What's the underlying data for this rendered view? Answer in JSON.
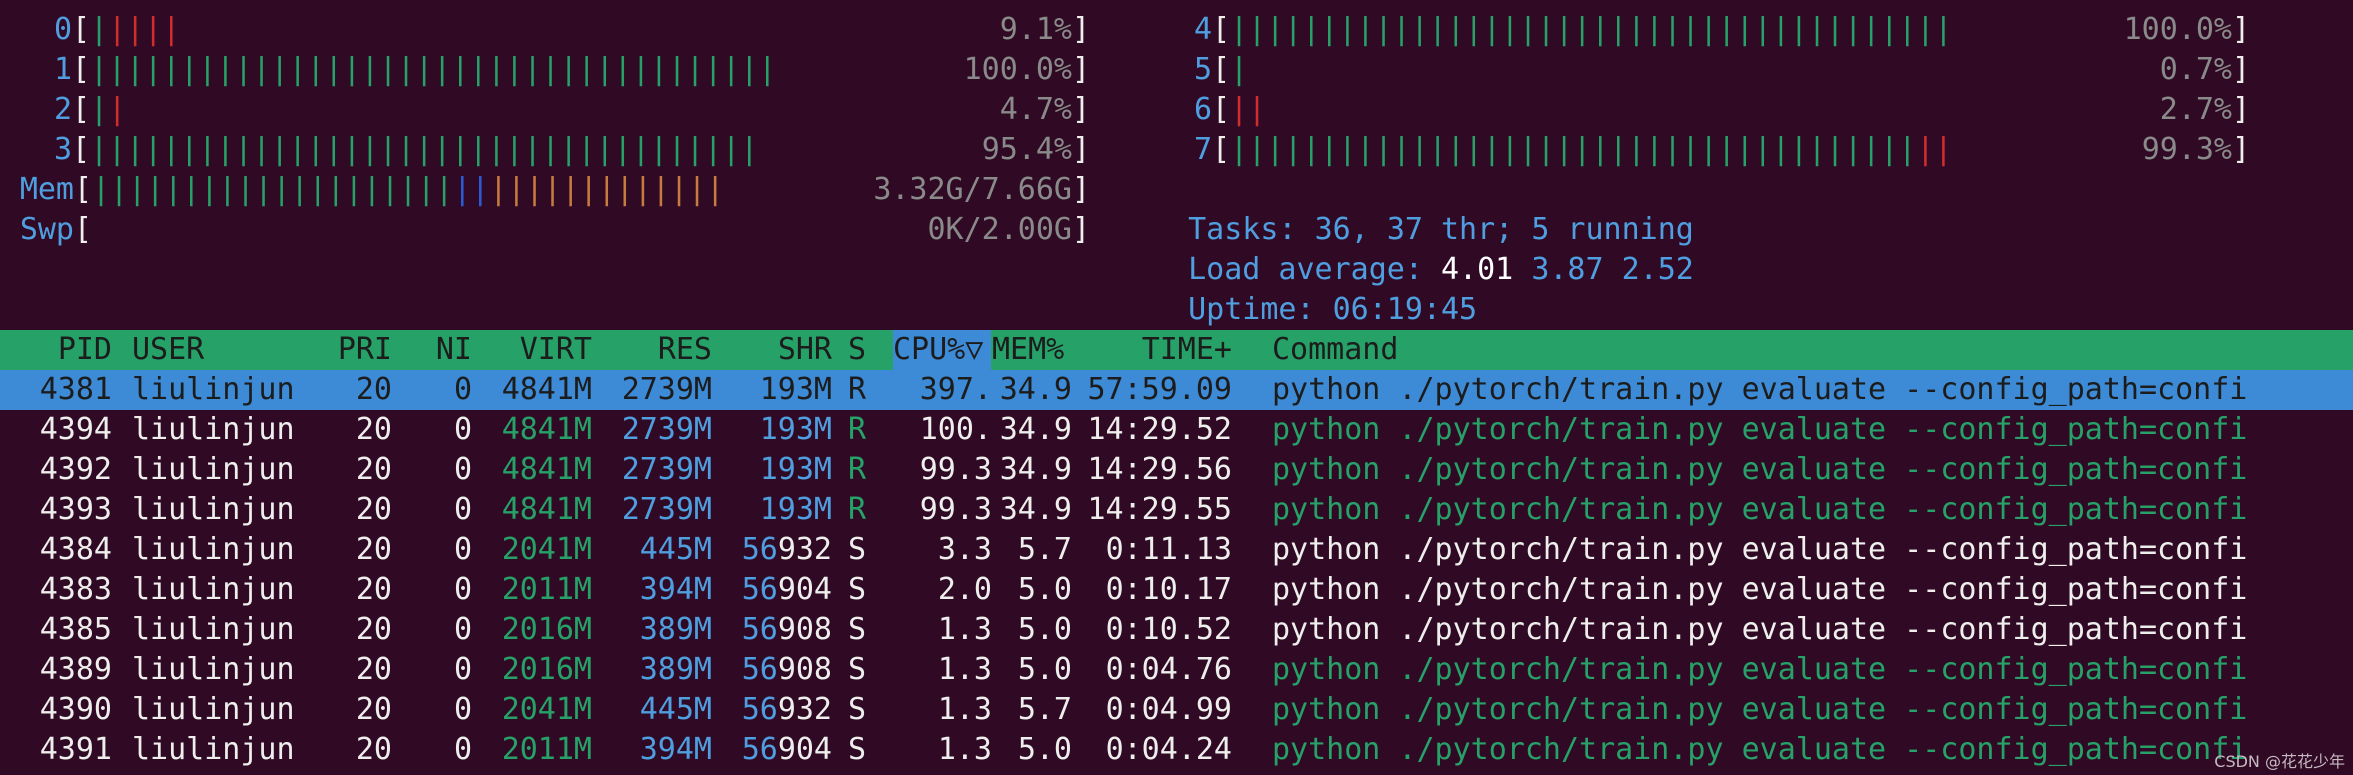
{
  "cpus": [
    {
      "label": "0",
      "value": "9.1%",
      "segments": [
        [
          "g",
          1
        ],
        [
          "r",
          4
        ]
      ]
    },
    {
      "label": "1",
      "value": "100.0%",
      "segments": [
        [
          "g",
          38
        ]
      ]
    },
    {
      "label": "2",
      "value": "4.7%",
      "segments": [
        [
          "g",
          1
        ],
        [
          "r",
          1
        ]
      ]
    },
    {
      "label": "3",
      "value": "95.4%",
      "segments": [
        [
          "g",
          37
        ]
      ]
    },
    {
      "label": "4",
      "value": "100.0%",
      "segments": [
        [
          "g",
          40
        ]
      ]
    },
    {
      "label": "5",
      "value": "0.7%",
      "segments": [
        [
          "g",
          1
        ]
      ]
    },
    {
      "label": "6",
      "value": "2.7%",
      "segments": [
        [
          "r",
          2
        ]
      ]
    },
    {
      "label": "7",
      "value": "99.3%",
      "segments": [
        [
          "g",
          38
        ],
        [
          "r",
          2
        ]
      ]
    }
  ],
  "mem": {
    "label": "Mem",
    "value": "3.32G/7.66G",
    "segments": [
      [
        "g",
        20
      ],
      [
        "b",
        2
      ],
      [
        "o",
        13
      ]
    ]
  },
  "swp": {
    "label": "Swp",
    "value": "0K/2.00G"
  },
  "tasks": {
    "label": "Tasks: ",
    "count": "36",
    "thr": "37",
    "running": "5",
    "text": "Tasks: 36, 37 thr; 5 running"
  },
  "load": {
    "label": "Load average: ",
    "one": "4.01",
    "five": "3.87",
    "fifteen": "2.52"
  },
  "uptime": {
    "label": "Uptime: ",
    "value": "06:19:45"
  },
  "columns": [
    "PID",
    "USER",
    "PRI",
    "NI",
    "VIRT",
    "RES",
    "SHR",
    "S",
    "CPU%▽",
    "MEM%",
    "TIME+",
    "Command"
  ],
  "processes": [
    {
      "pid": "4381",
      "user": "liulinjun",
      "pri": "20",
      "ni": "0",
      "virt": "4841M",
      "res": "2739M",
      "shr": "193M",
      "s": "R",
      "cpu": "397.",
      "mem": "34.9",
      "time": "57:59.09",
      "cmd": "python ./pytorch/train.py evaluate --config_path=confi",
      "selected": true,
      "thread": false
    },
    {
      "pid": "4394",
      "user": "liulinjun",
      "pri": "20",
      "ni": "0",
      "virt": "4841M",
      "res": "2739M",
      "shr": "193M",
      "s": "R",
      "cpu": "100.",
      "mem": "34.9",
      "time": "14:29.52",
      "cmd": "python ./pytorch/train.py evaluate --config_path=confi",
      "selected": false,
      "thread": true
    },
    {
      "pid": "4392",
      "user": "liulinjun",
      "pri": "20",
      "ni": "0",
      "virt": "4841M",
      "res": "2739M",
      "shr": "193M",
      "s": "R",
      "cpu": "99.3",
      "mem": "34.9",
      "time": "14:29.56",
      "cmd": "python ./pytorch/train.py evaluate --config_path=confi",
      "selected": false,
      "thread": true
    },
    {
      "pid": "4393",
      "user": "liulinjun",
      "pri": "20",
      "ni": "0",
      "virt": "4841M",
      "res": "2739M",
      "shr": "193M",
      "s": "R",
      "cpu": "99.3",
      "mem": "34.9",
      "time": "14:29.55",
      "cmd": "python ./pytorch/train.py evaluate --config_path=confi",
      "selected": false,
      "thread": true
    },
    {
      "pid": "4384",
      "user": "liulinjun",
      "pri": "20",
      "ni": "0",
      "virt": "2041M",
      "res": "445M",
      "shr": "56932",
      "s": "S",
      "cpu": "3.3",
      "mem": "5.7",
      "time": "0:11.13",
      "cmd": "python ./pytorch/train.py evaluate --config_path=confi",
      "selected": false,
      "thread": false
    },
    {
      "pid": "4383",
      "user": "liulinjun",
      "pri": "20",
      "ni": "0",
      "virt": "2011M",
      "res": "394M",
      "shr": "56904",
      "s": "S",
      "cpu": "2.0",
      "mem": "5.0",
      "time": "0:10.17",
      "cmd": "python ./pytorch/train.py evaluate --config_path=confi",
      "selected": false,
      "thread": false
    },
    {
      "pid": "4385",
      "user": "liulinjun",
      "pri": "20",
      "ni": "0",
      "virt": "2016M",
      "res": "389M",
      "shr": "56908",
      "s": "S",
      "cpu": "1.3",
      "mem": "5.0",
      "time": "0:10.52",
      "cmd": "python ./pytorch/train.py evaluate --config_path=confi",
      "selected": false,
      "thread": false
    },
    {
      "pid": "4389",
      "user": "liulinjun",
      "pri": "20",
      "ni": "0",
      "virt": "2016M",
      "res": "389M",
      "shr": "56908",
      "s": "S",
      "cpu": "1.3",
      "mem": "5.0",
      "time": "0:04.76",
      "cmd": "python ./pytorch/train.py evaluate --config_path=confi",
      "selected": false,
      "thread": true
    },
    {
      "pid": "4390",
      "user": "liulinjun",
      "pri": "20",
      "ni": "0",
      "virt": "2041M",
      "res": "445M",
      "shr": "56932",
      "s": "S",
      "cpu": "1.3",
      "mem": "5.7",
      "time": "0:04.99",
      "cmd": "python ./pytorch/train.py evaluate --config_path=confi",
      "selected": false,
      "thread": true
    },
    {
      "pid": "4391",
      "user": "liulinjun",
      "pri": "20",
      "ni": "0",
      "virt": "2011M",
      "res": "394M",
      "shr": "56904",
      "s": "S",
      "cpu": "1.3",
      "mem": "5.0",
      "time": "0:04.24",
      "cmd": "python ./pytorch/train.py evaluate --config_path=confi",
      "selected": false,
      "thread": true
    }
  ],
  "watermark": "CSDN @花花少年",
  "colors": {
    "background": "#300a24",
    "header": "#26a269",
    "selection": "#3d8bd6",
    "label": "#4f9fe0",
    "green": "#26a269",
    "red": "#d22d2d"
  }
}
